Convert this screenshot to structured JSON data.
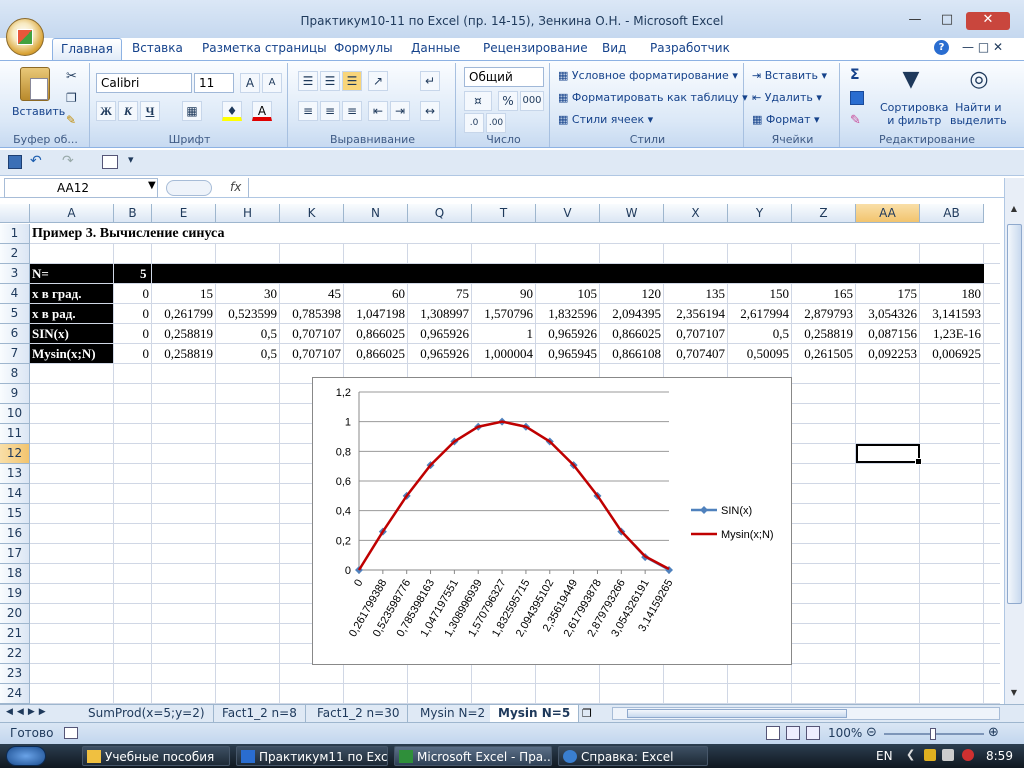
{
  "window": {
    "title": "Практикум10-11 по Excel (пр. 14-15), Зенкина О.Н. - Microsoft Excel"
  },
  "ribbon": {
    "tabs": [
      "Главная",
      "Вставка",
      "Разметка страницы",
      "Формулы",
      "Данные",
      "Рецензирование",
      "Вид",
      "Разработчик"
    ],
    "active_tab": "Главная",
    "clipboard": {
      "paste_label": "Вставить",
      "group_label": "Буфер об..."
    },
    "font": {
      "name": "Calibri",
      "size": "11",
      "group_label": "Шрифт",
      "bold": "Ж",
      "italic": "К",
      "underline": "Ч"
    },
    "alignment": {
      "group_label": "Выравнивание"
    },
    "number": {
      "format": "Общий",
      "group_label": "Число",
      "percent": "%",
      "thousands": "000"
    },
    "styles": {
      "conditional": "Условное форматирование",
      "table": "Форматировать как таблицу",
      "cell_styles": "Стили ячеек",
      "group_label": "Стили"
    },
    "cells": {
      "insert": "Вставить",
      "delete": "Удалить",
      "format": "Формат",
      "group_label": "Ячейки"
    },
    "editing": {
      "sigma": "Σ",
      "sort_line1": "Сортировка",
      "sort_line2": "и фильтр",
      "find_line1": "Найти и",
      "find_line2": "выделить",
      "group_label": "Редактирование"
    }
  },
  "formula_bar": {
    "name_box": "AA12",
    "fx": "fx",
    "value": ""
  },
  "grid": {
    "columns": [
      "A",
      "B",
      "E",
      "H",
      "K",
      "N",
      "Q",
      "T",
      "V",
      "W",
      "X",
      "Y",
      "Z",
      "AA",
      "AB"
    ],
    "selected_column": "AA",
    "row_numbers": [
      "1",
      "2",
      "3",
      "4",
      "5",
      "6",
      "7",
      "8",
      "9",
      "10",
      "11",
      "12",
      "13",
      "14",
      "15",
      "16",
      "17",
      "18",
      "19",
      "20",
      "21",
      "22",
      "23",
      "24"
    ],
    "selected_row": "12",
    "title": "Пример 3. Вычисление синуса",
    "n_label": "N=",
    "n_value": "5",
    "rows": [
      {
        "label": "x в град.",
        "values": [
          "0",
          "15",
          "30",
          "45",
          "60",
          "75",
          "90",
          "105",
          "120",
          "135",
          "150",
          "165",
          "175",
          "180"
        ]
      },
      {
        "label": "x  в рад.",
        "values": [
          "0",
          "0,261799",
          "0,523599",
          "0,785398",
          "1,047198",
          "1,308997",
          "1,570796",
          "1,832596",
          "2,094395",
          "2,356194",
          "2,617994",
          "2,879793",
          "3,054326",
          "3,141593"
        ]
      },
      {
        "label": "SIN(x)",
        "values": [
          "0",
          "0,258819",
          "0,5",
          "0,707107",
          "0,866025",
          "0,965926",
          "1",
          "0,965926",
          "0,866025",
          "0,707107",
          "0,5",
          "0,258819",
          "0,087156",
          "1,23E-16"
        ]
      },
      {
        "label": "Mysin(x;N)",
        "values": [
          "0",
          "0,258819",
          "0,5",
          "0,707107",
          "0,866025",
          "0,965926",
          "1,000004",
          "0,965945",
          "0,866108",
          "0,707407",
          "0,50095",
          "0,261505",
          "0,092253",
          "0,006925"
        ]
      }
    ]
  },
  "chart_data": {
    "type": "line",
    "categories": [
      "0",
      "0,261799388",
      "0,523598776",
      "0,785398163",
      "1,047197551",
      "1,308996939",
      "1,570796327",
      "1,832595715",
      "2,094395102",
      "2,35619449",
      "2,617993878",
      "2,879793266",
      "3,054326191",
      "3,14159265"
    ],
    "series": [
      {
        "name": "SIN(x)",
        "color": "#4f81bd",
        "marker": "diamond",
        "values": [
          0,
          0.258819,
          0.5,
          0.707107,
          0.866025,
          0.965926,
          1,
          0.965926,
          0.866025,
          0.707107,
          0.5,
          0.258819,
          0.087156,
          1e-16
        ]
      },
      {
        "name": "Mysin(x;N)",
        "color": "#c00000",
        "marker": "none",
        "values": [
          0,
          0.258819,
          0.5,
          0.707107,
          0.866025,
          0.965926,
          1.000004,
          0.965945,
          0.866108,
          0.707407,
          0.50095,
          0.261505,
          0.092253,
          0.006925
        ]
      }
    ],
    "ylim": [
      0,
      1.2
    ],
    "yticks": [
      "0",
      "0,2",
      "0,4",
      "0,6",
      "0,8",
      "1",
      "1,2"
    ],
    "grid": true,
    "legend": "right",
    "title": "",
    "xlabel": "",
    "ylabel": ""
  },
  "sheets": {
    "tabs": [
      "SumProd(x=5;y=2)",
      "Fact1_2 n=8",
      "Fact1_2 n=30",
      "Mysin N=2",
      "Mysin N=5"
    ],
    "active": "Mysin N=5"
  },
  "status": {
    "ready": "Готово",
    "zoom": "100%"
  },
  "taskbar": {
    "items": [
      "Учебные пособия",
      "Практикум11 по Exc...",
      "Microsoft Excel - Пра...",
      "Справка: Excel"
    ],
    "active_index": 2,
    "lang": "EN",
    "clock": "8:59"
  }
}
